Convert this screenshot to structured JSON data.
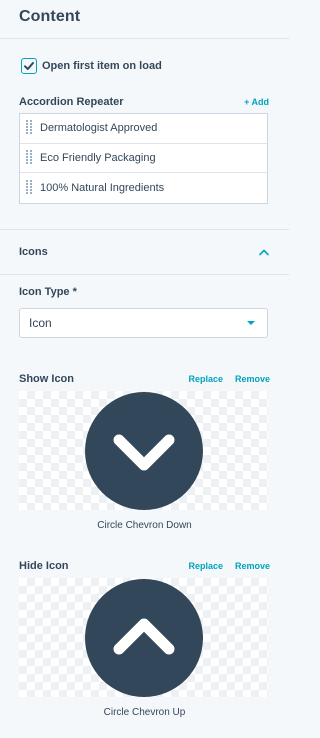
{
  "header": {
    "title": "Content"
  },
  "options": {
    "open_first_item": {
      "label": "Open first item on load",
      "checked": true
    }
  },
  "repeater": {
    "label": "Accordion Repeater",
    "add_label": "+ Add",
    "items": [
      {
        "label": "Dermatologist Approved"
      },
      {
        "label": "Eco Friendly Packaging"
      },
      {
        "label": "100% Natural Ingredients"
      }
    ]
  },
  "icons_section": {
    "title": "Icons",
    "expanded": true,
    "icon_type": {
      "label": "Icon Type *",
      "value": "Icon"
    },
    "show_icon": {
      "label": "Show Icon",
      "replace_label": "Replace",
      "remove_label": "Remove",
      "icon_name": "circle-chevron-down-icon",
      "caption": "Circle Chevron Down"
    },
    "hide_icon": {
      "label": "Hide Icon",
      "replace_label": "Replace",
      "remove_label": "Remove",
      "icon_name": "circle-chevron-up-icon",
      "caption": "Circle Chevron Up"
    }
  },
  "colors": {
    "accent": "#00a4bd",
    "text": "#33475b",
    "icon_fill": "#33475b",
    "panel_bg": "#f5f8fa",
    "border": "#cbd6e2"
  }
}
